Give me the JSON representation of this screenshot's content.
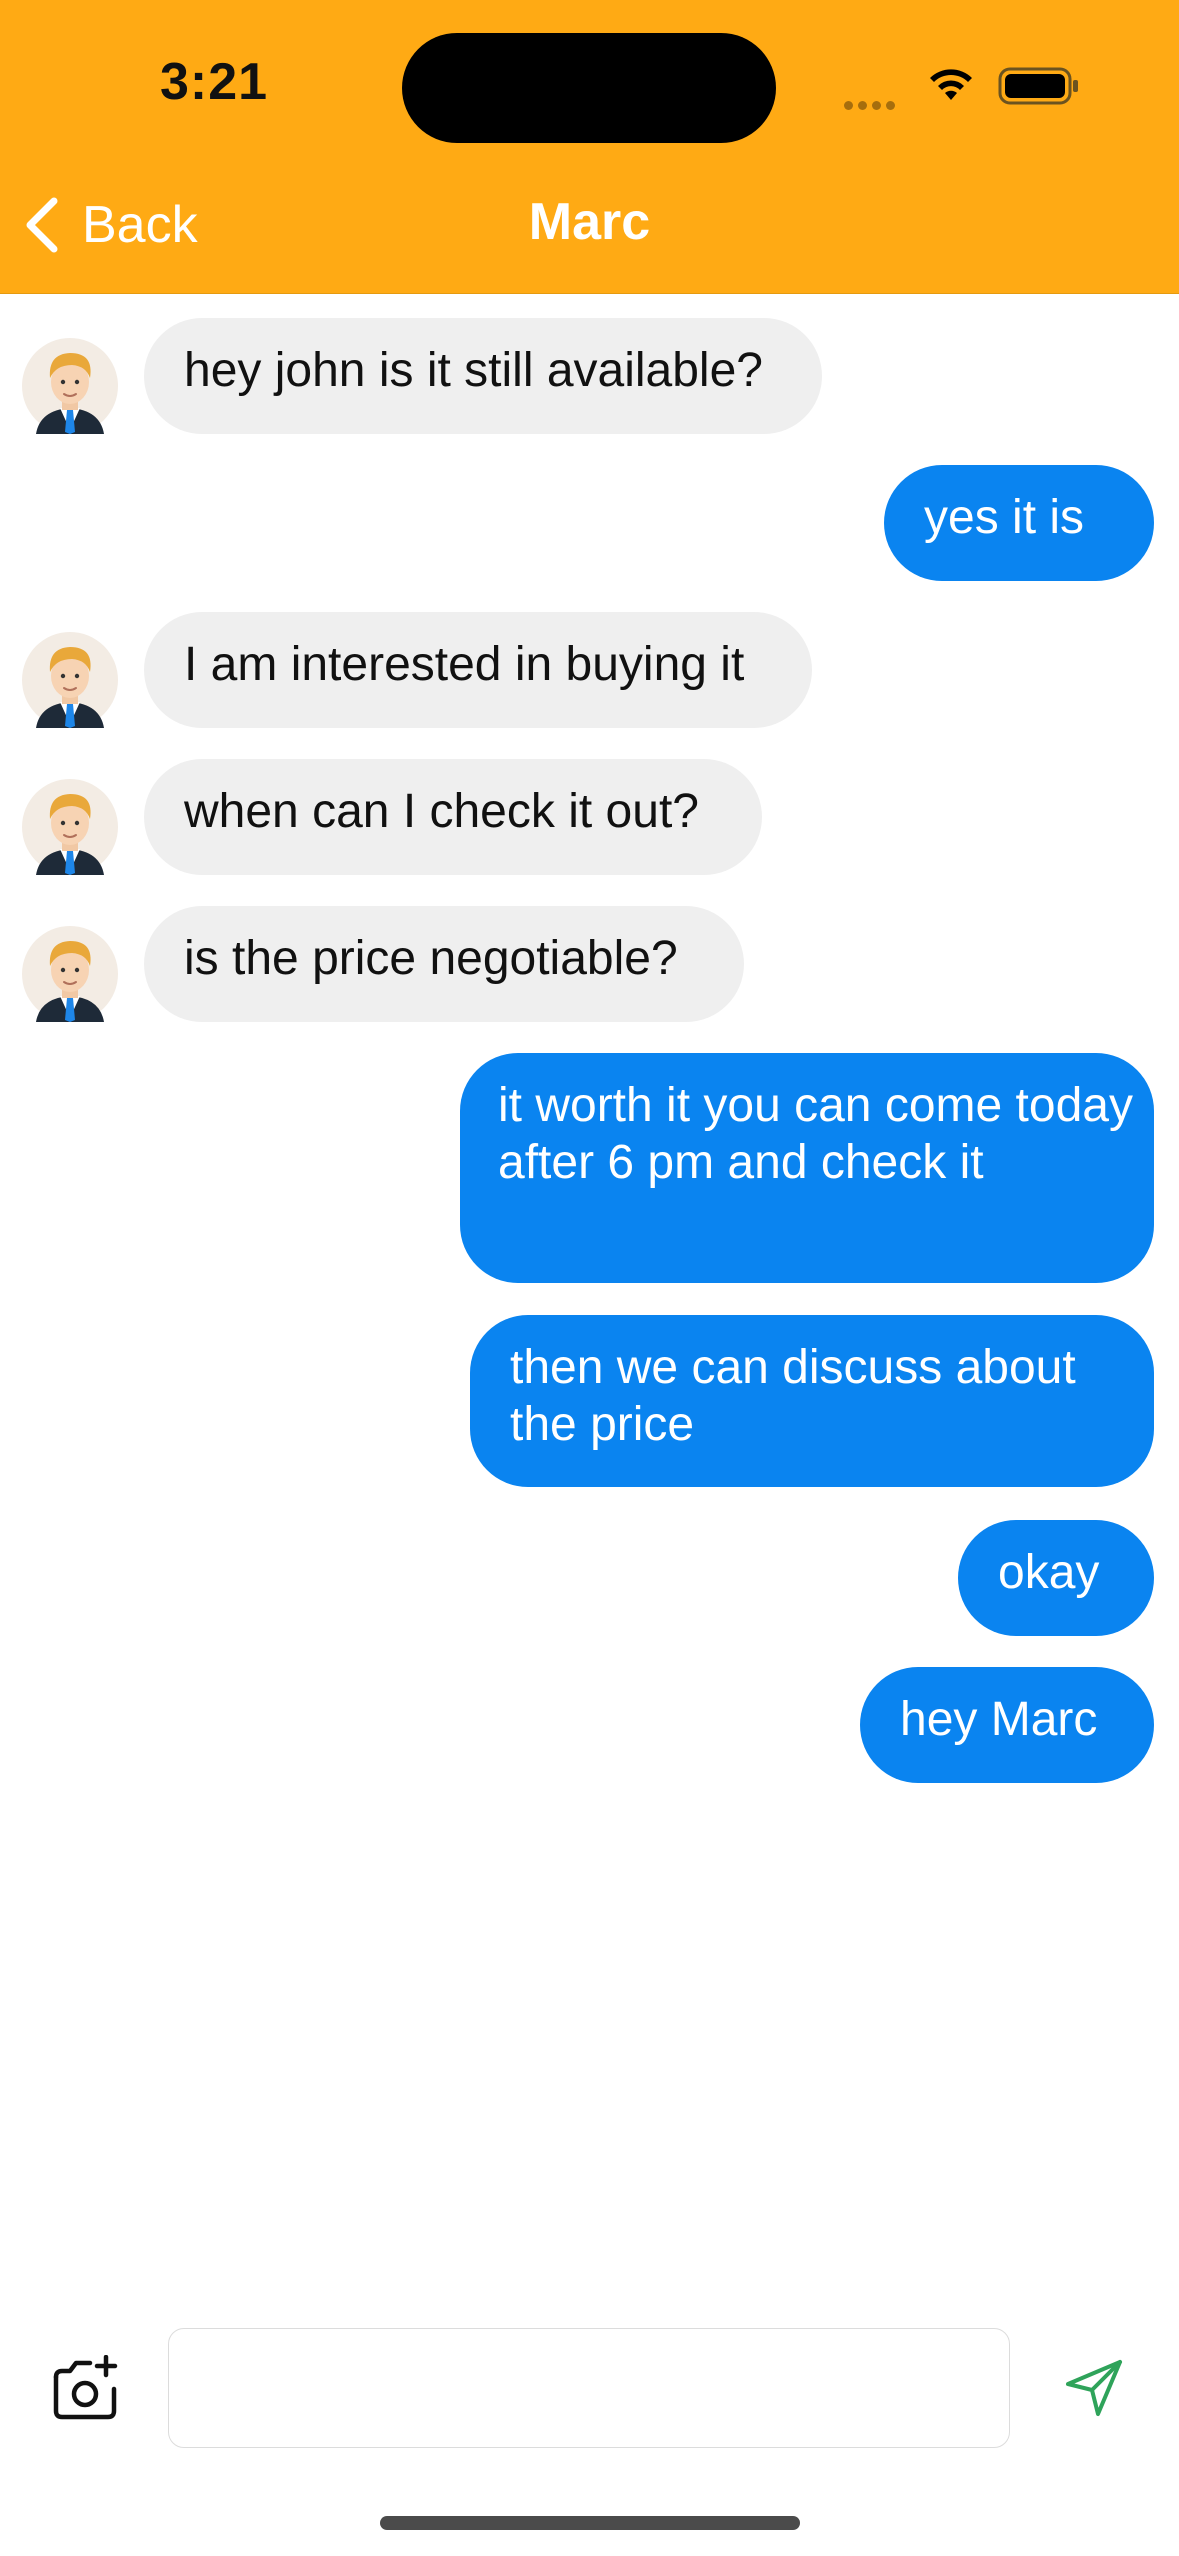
{
  "status_bar": {
    "time": "3:21"
  },
  "nav": {
    "back_label": "Back",
    "title": "Marc"
  },
  "colors": {
    "header": "#FFAA14",
    "outgoing_bubble": "#0A84F0",
    "incoming_bubble": "#EFEFEF",
    "send_icon": "#2FA35A"
  },
  "messages": [
    {
      "sender": "Marc",
      "direction": "incoming",
      "text": "hey john is it still available?"
    },
    {
      "sender": "me",
      "direction": "outgoing",
      "text": "yes it is"
    },
    {
      "sender": "Marc",
      "direction": "incoming",
      "text": "I am interested in buying it"
    },
    {
      "sender": "Marc",
      "direction": "incoming",
      "text": "when can I check it out?"
    },
    {
      "sender": "Marc",
      "direction": "incoming",
      "text": "is the price negotiable?"
    },
    {
      "sender": "me",
      "direction": "outgoing",
      "text": "it worth it you can come today after 6 pm and check it"
    },
    {
      "sender": "me",
      "direction": "outgoing",
      "text": "then we can discuss about the price"
    },
    {
      "sender": "me",
      "direction": "outgoing",
      "text": "okay"
    },
    {
      "sender": "me",
      "direction": "outgoing",
      "text": "hey Marc"
    }
  ],
  "composer": {
    "value": "",
    "placeholder": ""
  },
  "icons": {
    "back": "chevron-left-icon",
    "camera": "camera-add-icon",
    "send": "paper-plane-icon",
    "avatar": "man-avatar-icon"
  }
}
